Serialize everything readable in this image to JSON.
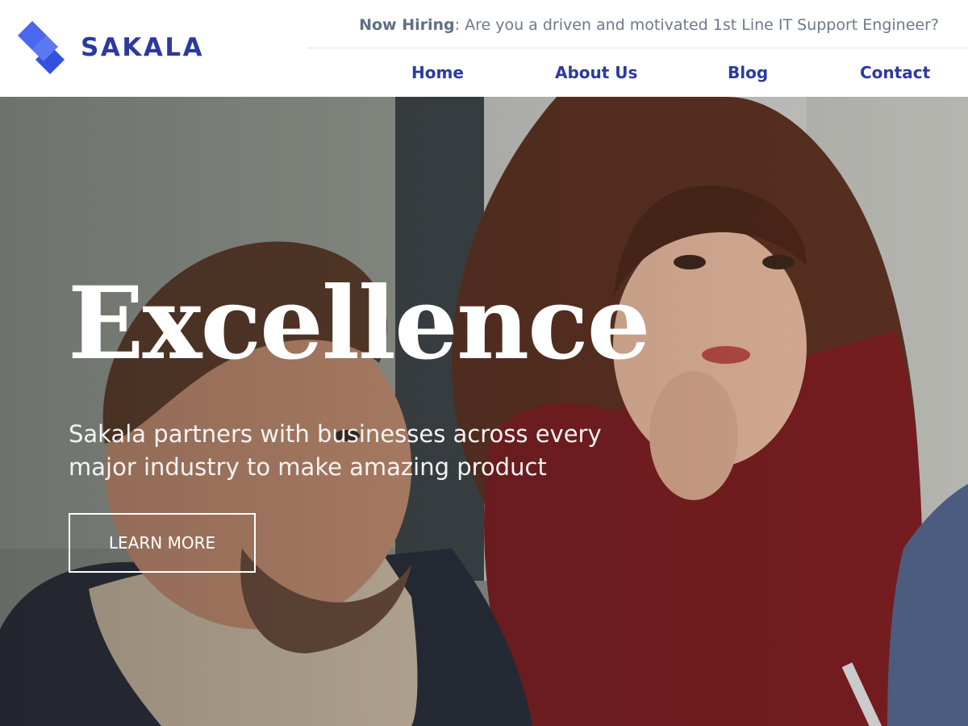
{
  "brand": {
    "name": "SAKALA",
    "accent": "#2c3a9f",
    "logo_color": "#3d5de8"
  },
  "topbar": {
    "hiring_label": "Now Hiring",
    "hiring_text": ": Are you a driven and motivated 1st Line IT Support Engineer?"
  },
  "nav": {
    "items": [
      {
        "label": "Home"
      },
      {
        "label": "About Us"
      },
      {
        "label": "Blog"
      },
      {
        "label": "Contact"
      }
    ]
  },
  "hero": {
    "title": "Excellence",
    "subtitle": "Sakala partners with businesses across every major industry to make amazing product",
    "cta_label": "LEARN MORE"
  }
}
